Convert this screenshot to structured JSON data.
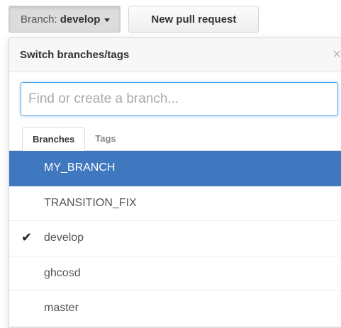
{
  "toolbar": {
    "branch_prefix": "Branch:",
    "branch_name": "develop",
    "new_pr_label": "New pull request"
  },
  "dropdown": {
    "title": "Switch branches/tags",
    "close_icon": "×",
    "filter_placeholder": "Find or create a branch...",
    "filter_value": "",
    "tabs": [
      {
        "label": "Branches",
        "active": true
      },
      {
        "label": "Tags",
        "active": false
      }
    ],
    "branches": [
      {
        "name": "MY_BRANCH",
        "highlighted": true,
        "checked": false
      },
      {
        "name": "TRANSITION_FIX",
        "highlighted": false,
        "checked": false
      },
      {
        "name": "develop",
        "highlighted": false,
        "checked": true
      },
      {
        "name": "ghcosd",
        "highlighted": false,
        "checked": false
      },
      {
        "name": "master",
        "highlighted": false,
        "checked": false
      }
    ],
    "check_icon": "✔"
  },
  "colors": {
    "highlight": "#4078c0",
    "focus_border": "#51a7e8"
  }
}
